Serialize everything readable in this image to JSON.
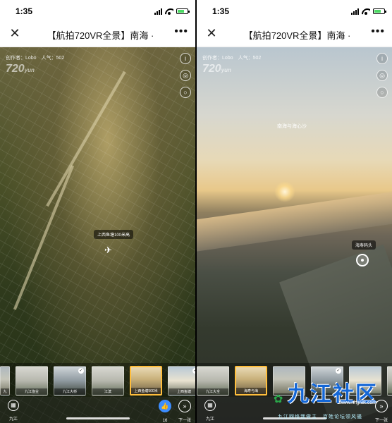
{
  "left": {
    "status": {
      "time": "1:35"
    },
    "title": "【航拍720VR全景】南海 ·",
    "meta": "创作者：Lobo　人气：502",
    "logo_main": "720",
    "logo_sub": "yun",
    "hotspot_label": "上西鱼塘100米高",
    "thumbs": [
      {
        "label": "九"
      },
      {
        "label": "九江渔业"
      },
      {
        "label": "九江大桥"
      },
      {
        "label": "江滨"
      },
      {
        "label": "上西鱼塘500米"
      },
      {
        "label": "上西鱼塘"
      }
    ],
    "bottom": {
      "category": "九江",
      "like_count": "16",
      "next": "下一张"
    }
  },
  "right": {
    "status": {
      "time": "1:35"
    },
    "title": "【航拍720VR全景】南海 ·",
    "meta": "创作者：Lobo　人气：502",
    "logo_main": "720",
    "logo_sub": "yun",
    "sky_label": "南海与海心沙",
    "hotspot_label": "海寿码头",
    "thumbs": [
      {
        "label": "九江大全"
      },
      {
        "label": "海寿与海"
      },
      {
        "label": ""
      },
      {
        "label": ""
      },
      {
        "label": ""
      },
      {
        "label": ""
      }
    ],
    "bottom": {
      "category": "九江",
      "next": "下一张"
    }
  },
  "watermark": {
    "title": "九江社区",
    "url": "www.nhjjnet.com",
    "slogan": "九江网络我做主　百姓论坛领风骚"
  }
}
